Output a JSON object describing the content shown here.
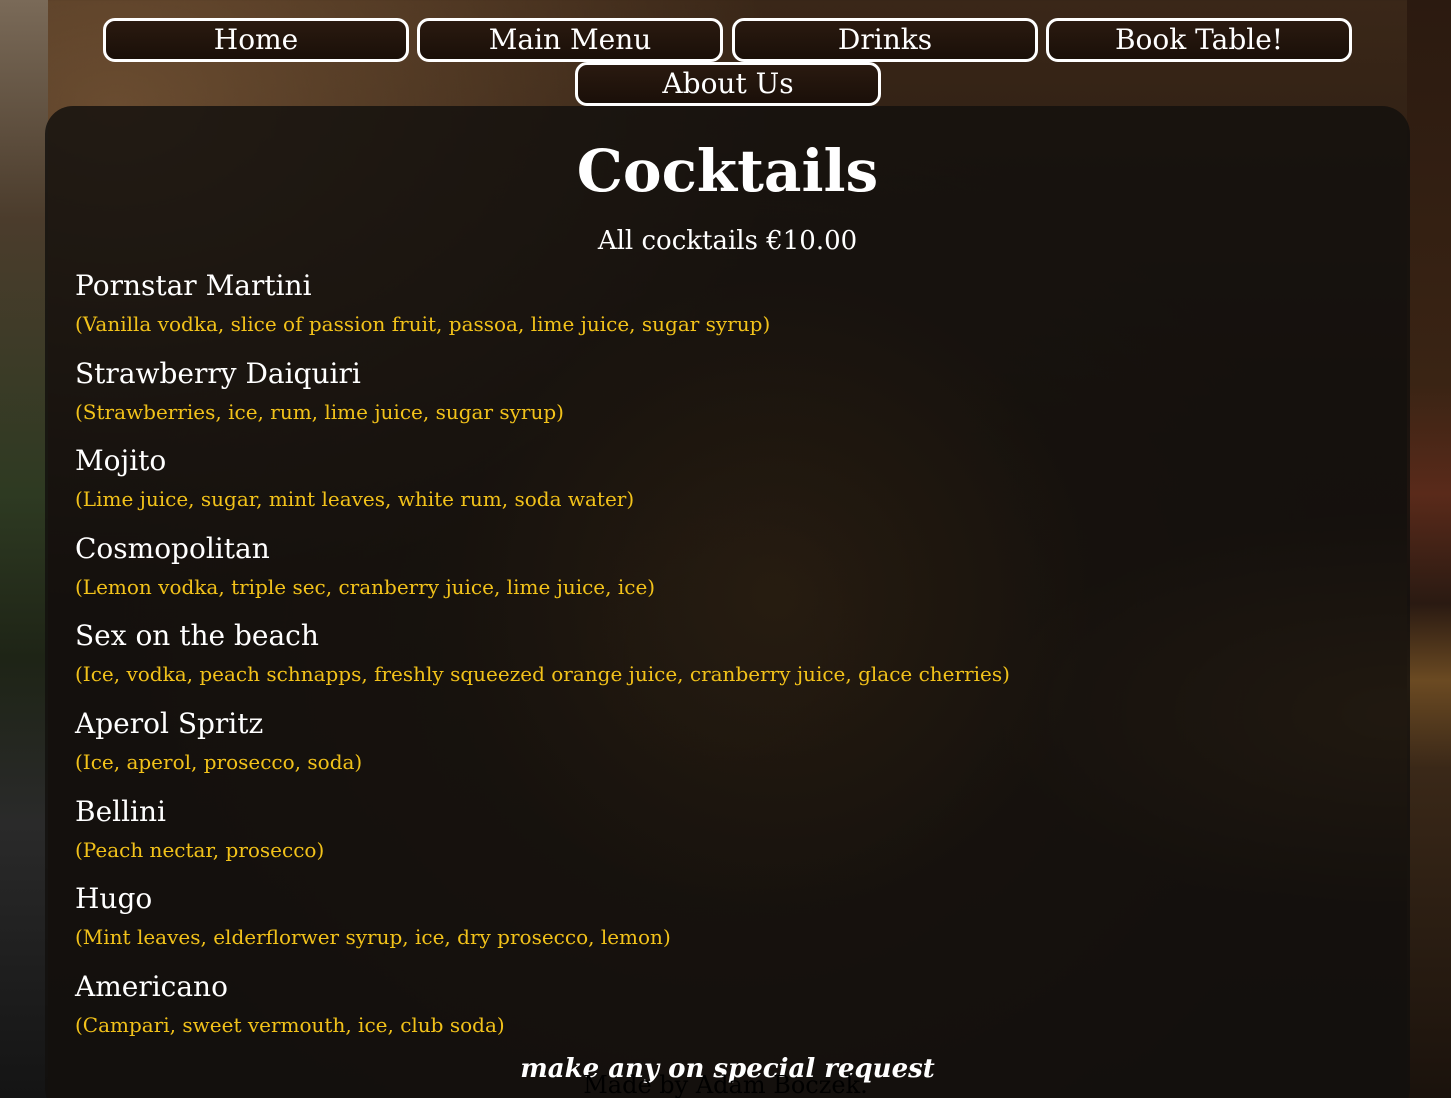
{
  "nav": {
    "home": "Home",
    "main_menu": "Main Menu",
    "drinks": "Drinks",
    "book_table": "Book Table!",
    "about_us": "About Us"
  },
  "page": {
    "title": "Cocktails",
    "price_note": "All cocktails €10.00",
    "special_note": "make any on special request"
  },
  "cocktails": [
    {
      "name": "Pornstar Martini",
      "ingredients": "(Vanilla vodka, slice of passion fruit, passoa, lime juice, sugar syrup)"
    },
    {
      "name": "Strawberry Daiquiri",
      "ingredients": "(Strawberries, ice, rum, lime juice, sugar syrup)"
    },
    {
      "name": "Mojito",
      "ingredients": "(Lime juice, sugar, mint leaves, white rum, soda water)"
    },
    {
      "name": "Cosmopolitan",
      "ingredients": "(Lemon vodka, triple sec, cranberry juice, lime juice, ice)"
    },
    {
      "name": "Sex on the beach",
      "ingredients": "(Ice, vodka, peach schnapps, freshly squeezed orange juice, cranberry juice, glace cherries)"
    },
    {
      "name": "Aperol Spritz",
      "ingredients": "(Ice, aperol, prosecco, soda)"
    },
    {
      "name": "Bellini",
      "ingredients": "(Peach nectar, prosecco)"
    },
    {
      "name": "Hugo",
      "ingredients": "(Mint leaves, elderflorwer syrup, ice, dry prosecco, lemon)"
    },
    {
      "name": "Americano",
      "ingredients": "(Campari, sweet vermouth, ice, club soda)"
    }
  ],
  "footer": {
    "credit": "Made by Adam Boczek."
  },
  "colors": {
    "ingredient_text": "#f2c21a",
    "name_text": "#ffffff",
    "nav_border": "#ffffff"
  }
}
